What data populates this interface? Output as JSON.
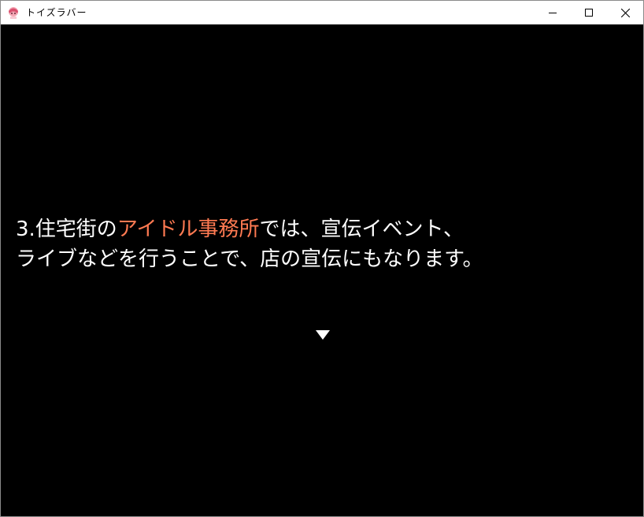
{
  "window": {
    "title": "トイズラバー",
    "icon": "character-face-icon"
  },
  "controls": {
    "minimize_icon": "minimize-icon",
    "maximize_icon": "maximize-icon",
    "close_icon": "close-icon"
  },
  "dialogue": {
    "line1_before": "3.住宅街の",
    "line1_highlight": "アイドル事務所",
    "line1_after": "では、宣伝イベント、",
    "line2": "ライブなどを行うことで、店の宣伝にもなります。",
    "text_color": "#ffffff",
    "highlight_color": "#ff7a52",
    "continue_indicator": "down-triangle-icon"
  }
}
